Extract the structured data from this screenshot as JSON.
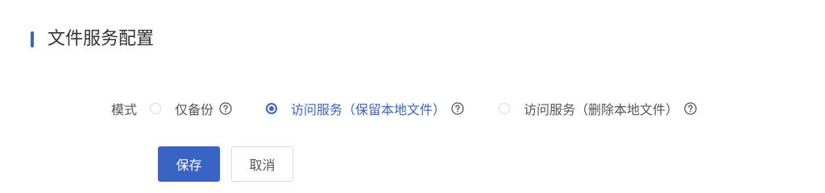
{
  "section": {
    "title": "文件服务配置"
  },
  "mode": {
    "label": "模式",
    "selected_index": 1,
    "options": [
      {
        "label": "仅备份",
        "help_icon": "question-circle-icon"
      },
      {
        "label": "访问服务（保留本地文件）",
        "help_icon": "question-circle-icon"
      },
      {
        "label": "访问服务（删除本地文件）",
        "help_icon": "question-circle-icon"
      }
    ]
  },
  "actions": {
    "save_label": "保存",
    "cancel_label": "取消"
  },
  "colors": {
    "accent": "#3a64c4",
    "text": "#555555",
    "border": "#dcdcdc"
  }
}
